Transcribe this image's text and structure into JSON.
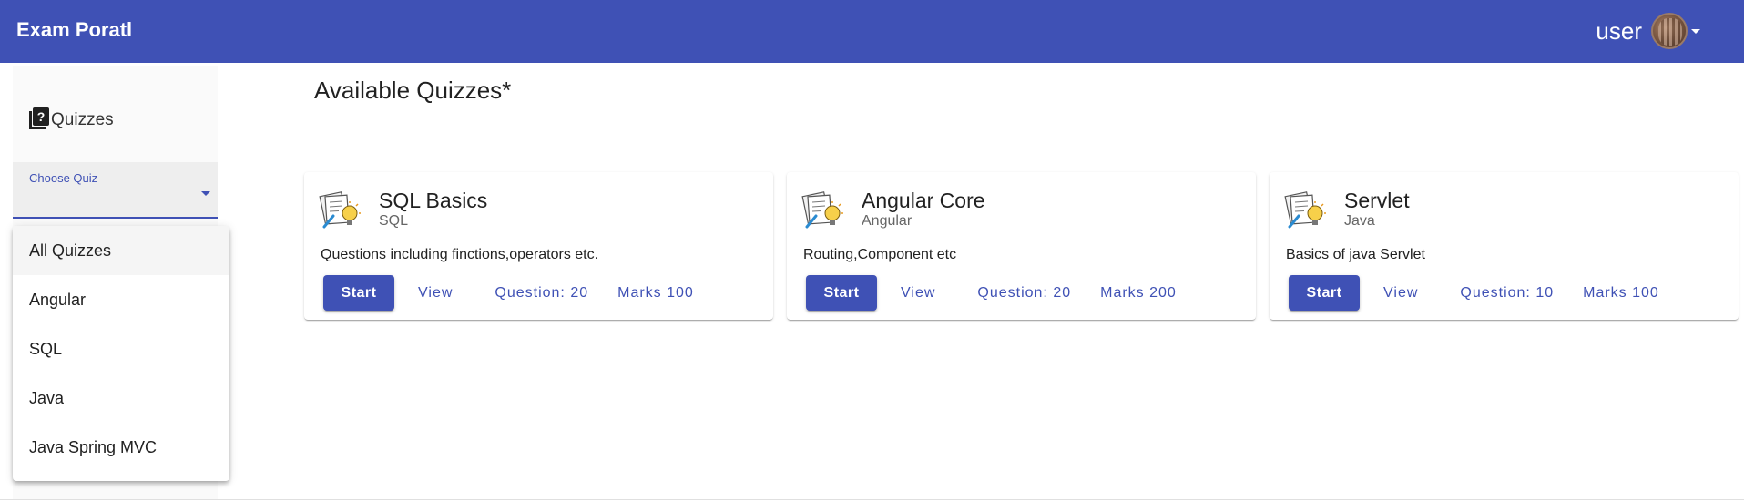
{
  "app": {
    "title": "Exam Poratl"
  },
  "user": {
    "name": "user",
    "avatar_icon": "avatar-photo",
    "menu_icon": "caret-down-icon"
  },
  "sidebar": {
    "nav_label": "Quizzes",
    "nav_icon": "quiz-icon",
    "select": {
      "label": "Choose Quiz",
      "value": ""
    },
    "options": [
      "All Quizzes",
      "Angular",
      "SQL",
      "Java",
      "Java Spring MVC"
    ],
    "highlighted_option": "All Quizzes"
  },
  "main": {
    "title": "Available Quizzes*",
    "quizzes": [
      {
        "title": "SQL Basics",
        "category": "SQL",
        "description": "Questions including finctions,operators etc.",
        "start_label": "Start",
        "view_label": "View",
        "questions_label": "Question: 20",
        "marks_label": "Marks 100"
      },
      {
        "title": "Angular Core",
        "category": "Angular",
        "description": "Routing,Component etc",
        "start_label": "Start",
        "view_label": "View",
        "questions_label": "Question: 20",
        "marks_label": "Marks 200"
      },
      {
        "title": "Servlet",
        "category": "Java",
        "description": "Basics of java Servlet",
        "start_label": "Start",
        "view_label": "View",
        "questions_label": "Question: 10",
        "marks_label": "Marks 100"
      }
    ]
  },
  "colors": {
    "primary": "#3f51b5",
    "background": "#ffffff",
    "sidebar": "#fafafa"
  }
}
